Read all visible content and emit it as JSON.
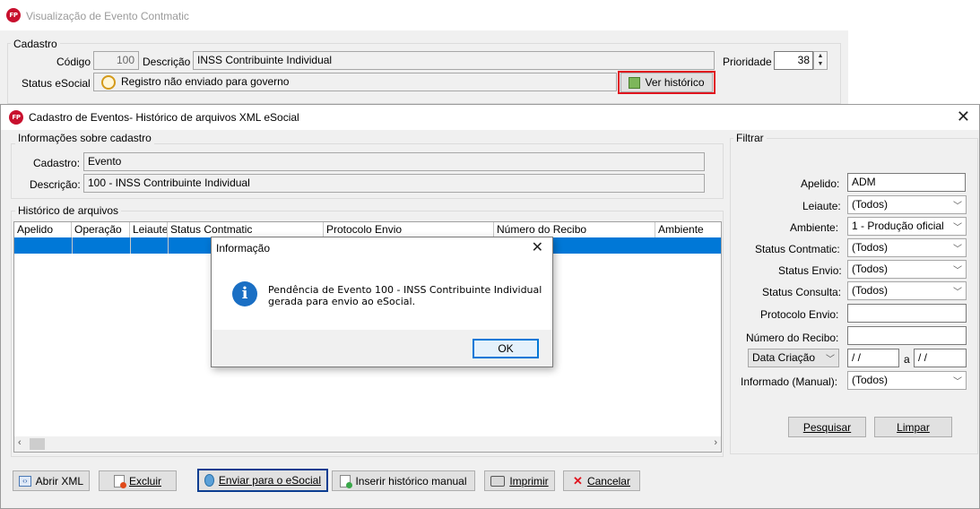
{
  "back_window": {
    "title": "Visualização de Evento Contmatic",
    "group_label": "Cadastro",
    "codigo_label": "Código",
    "codigo_value": "100",
    "descricao_label": "Descrição",
    "descricao_value": "INSS Contribuinte Individual",
    "prioridade_label": "Prioridade",
    "prioridade_value": "38",
    "status_label": "Status eSocial",
    "status_value": "Registro não enviado para governo",
    "ver_historico_label": "Ver histórico"
  },
  "main_dialog": {
    "title": "Cadastro de Eventos- Histórico de arquivos XML eSocial",
    "info_group_label": "Informações sobre cadastro",
    "cadastro_label": "Cadastro:",
    "cadastro_value": "Evento",
    "descricao_label": "Descrição:",
    "descricao_value": "100 - INSS Contribuinte Individual",
    "historico_group_label": "Histórico de arquivos",
    "columns": [
      "Apelido",
      "Operação",
      "Leiaute",
      "Status Contmatic",
      "Protocolo Envio",
      "Número do Recibo",
      "Ambiente"
    ],
    "filter": {
      "group_label": "Filtrar",
      "apelido_label": "Apelido:",
      "apelido_value": "ADM",
      "leiaute_label": "Leiaute:",
      "leiaute_value": "(Todos)",
      "ambiente_label": "Ambiente:",
      "ambiente_value": "1 - Produção oficial",
      "status_contmatic_label": "Status Contmatic:",
      "status_contmatic_value": "(Todos)",
      "status_envio_label": "Status Envio:",
      "status_envio_value": "(Todos)",
      "status_consulta_label": "Status Consulta:",
      "status_consulta_value": "(Todos)",
      "protocolo_label": "Protocolo Envio:",
      "protocolo_value": "",
      "recibo_label": "Número do Recibo:",
      "recibo_value": "",
      "data_type_value": "Data Criação",
      "date_from": " / /",
      "date_sep": "a",
      "date_to": " / /",
      "informado_label": "Informado (Manual):",
      "informado_value": "(Todos)",
      "pesquisar_label": "Pesquisar",
      "limpar_label": "Limpar"
    },
    "buttons": {
      "abrir_xml": "Abrir XML",
      "excluir": "Excluir",
      "enviar": "Enviar para o eSocial",
      "inserir": "Inserir histórico manual",
      "imprimir": "Imprimir",
      "cancelar": "Cancelar"
    }
  },
  "info_dialog": {
    "title": "Informação",
    "message_line1": "Pendência de Evento 100 - INSS Contribuinte Individual",
    "message_line2": "gerada para envio ao eSocial.",
    "ok_label": "OK"
  },
  "colors": {
    "selection": "#0078d7",
    "highlight_border": "#e0141e",
    "focus_border": "#0b3d91",
    "logo": "#c8102e"
  }
}
